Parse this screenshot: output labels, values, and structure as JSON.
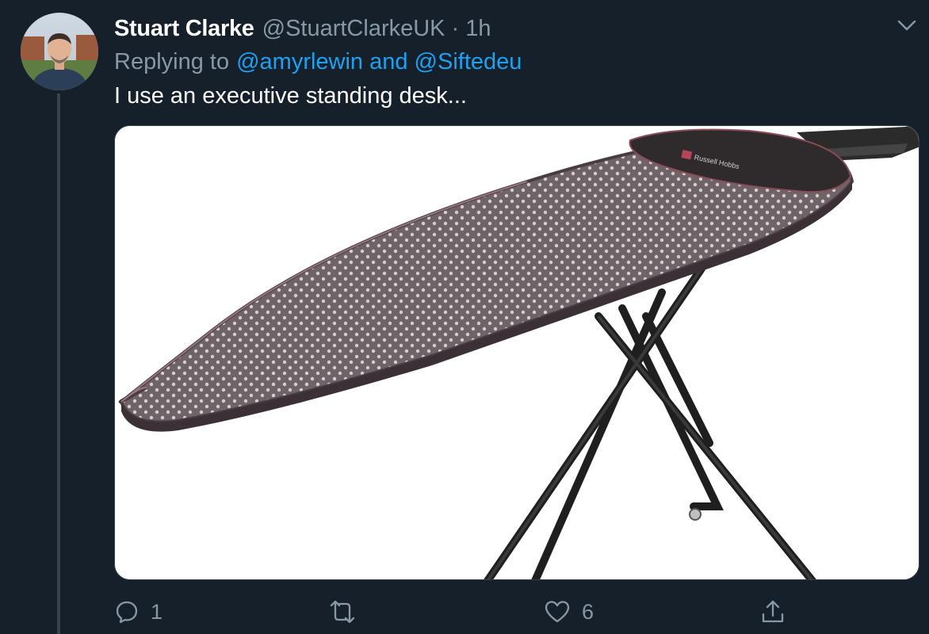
{
  "tweet": {
    "author_name": "Stuart Clarke",
    "handle": "@StuartClarkeUK",
    "separator": "·",
    "time": "1h",
    "replying_prefix": "Replying to",
    "replying_to": "@amyrlewin and @Siftedeu",
    "text": "I use an executive standing desk...",
    "media_subject": "ironing board",
    "media_logo_text": "Russell Hobbs"
  },
  "actions": {
    "reply_count": "1",
    "retweet_count": "",
    "like_count": "6"
  },
  "colors": {
    "background": "#15202b",
    "primary_text": "#ffffff",
    "secondary_text": "#8899a6",
    "link": "#1da1f2",
    "border": "#38444d"
  },
  "icons": {
    "reply": "reply-icon",
    "retweet": "retweet-icon",
    "like": "like-icon",
    "share": "share-icon",
    "more": "chevron-down-icon"
  }
}
